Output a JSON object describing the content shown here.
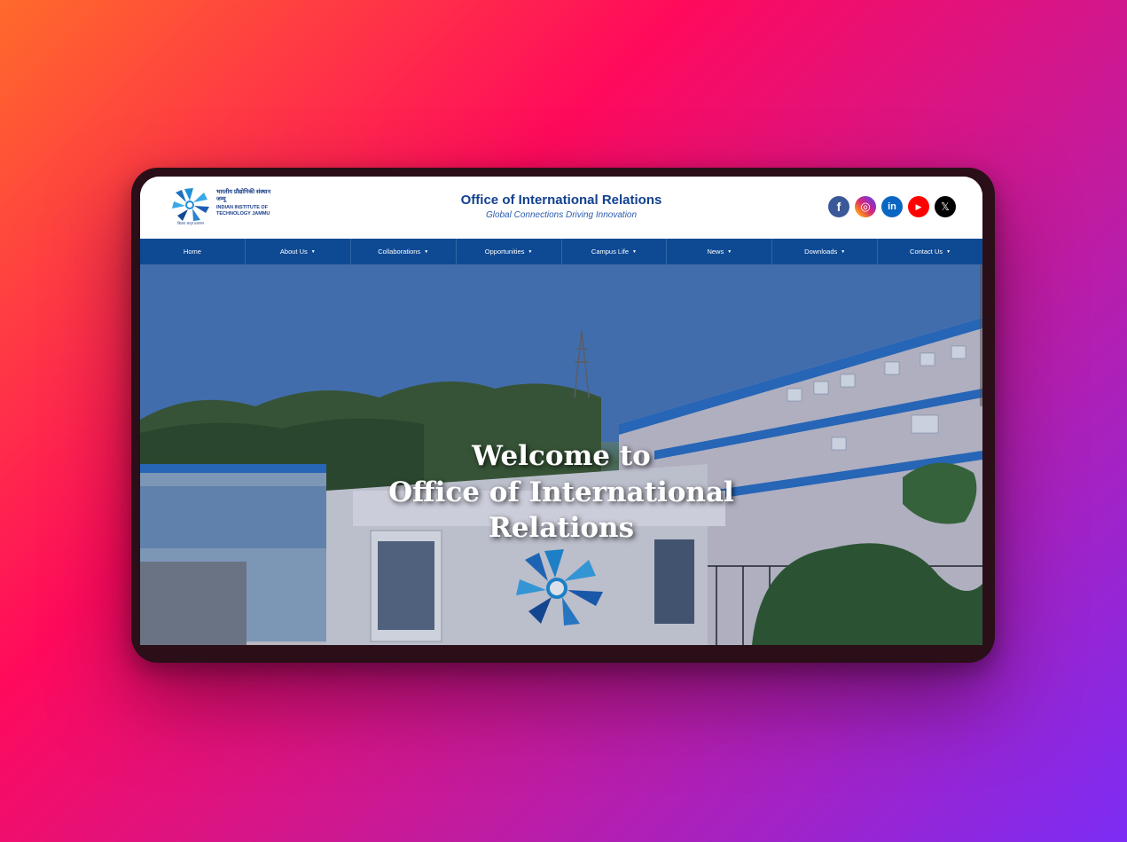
{
  "header": {
    "logo": {
      "hindi_name": "भारतीय प्रौद्योगिकी संस्थान जम्मू",
      "english_name": "INDIAN INSTITUTE OF TECHNOLOGY JAMMU",
      "motto": "विद्यया अमृतं प्रशासन"
    },
    "title": "Office of International Relations",
    "tagline": "Global Connections Driving Innovation",
    "socials": [
      {
        "name": "facebook-icon",
        "color": "#3b5998",
        "glyph": "f"
      },
      {
        "name": "instagram-icon",
        "color": "#d62976",
        "glyph": "◎"
      },
      {
        "name": "linkedin-icon",
        "color": "#0a66c2",
        "glyph": "in"
      },
      {
        "name": "youtube-icon",
        "color": "#ff0000",
        "glyph": "▶"
      },
      {
        "name": "x-icon",
        "color": "#000000",
        "glyph": "𝕏"
      }
    ]
  },
  "nav": {
    "items": [
      {
        "label": "Home",
        "dropdown": false
      },
      {
        "label": "About Us",
        "dropdown": true
      },
      {
        "label": "Collaborations",
        "dropdown": true
      },
      {
        "label": "Opportunities",
        "dropdown": true
      },
      {
        "label": "Campus Life",
        "dropdown": true
      },
      {
        "label": "News",
        "dropdown": true
      },
      {
        "label": "Downloads",
        "dropdown": true
      },
      {
        "label": "Contact Us",
        "dropdown": true
      }
    ],
    "caret": "▼"
  },
  "hero": {
    "line1": "Welcome to",
    "line2": "Office of International",
    "line3": "Relations"
  },
  "colors": {
    "nav_bg": "#0e4a94",
    "title": "#12418f"
  }
}
